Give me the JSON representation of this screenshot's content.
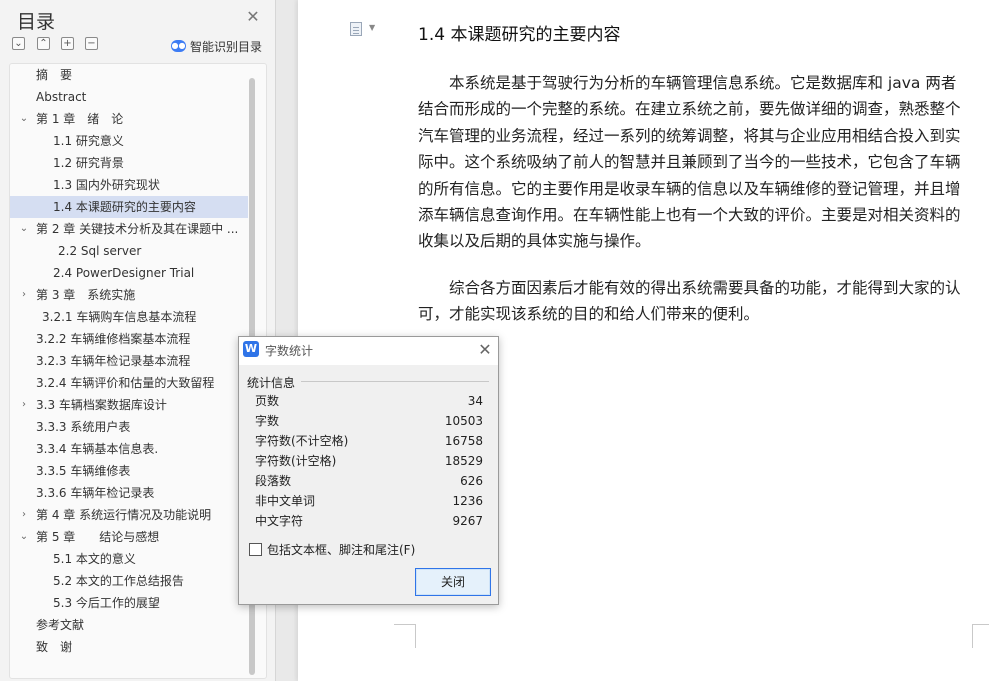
{
  "sidebar": {
    "title": "目录",
    "smart_toc_label": "智能识别目录",
    "tools": [
      "⌄",
      "⌃",
      "+",
      "−"
    ],
    "items": [
      {
        "label": "摘　要",
        "level": 0,
        "chevron": "",
        "selected": false
      },
      {
        "label": "Abstract",
        "level": 0,
        "chevron": "",
        "selected": false
      },
      {
        "label": "第 1 章　绪　论",
        "level": 0,
        "chevron": "expanded",
        "selected": false
      },
      {
        "label": "1.1 研究意义",
        "level": 1,
        "chevron": "",
        "selected": false
      },
      {
        "label": "1.2 研究背景",
        "level": 1,
        "chevron": "",
        "selected": false
      },
      {
        "label": "1.3 国内外研究现状",
        "level": 1,
        "chevron": "",
        "selected": false
      },
      {
        "label": "1.4 本课题研究的主要内容",
        "level": 1,
        "chevron": "",
        "selected": true
      },
      {
        "label": "第 2 章  关键技术分析及其在课题中 ...",
        "level": 0,
        "chevron": "expanded",
        "selected": false
      },
      {
        "label": "2.2 Sql server",
        "level": 2,
        "chevron": "",
        "selected": false
      },
      {
        "label": "2.4 PowerDesigner Trial",
        "level": 1,
        "chevron": "",
        "selected": false
      },
      {
        "label": "第 3 章　系统实施",
        "level": 0,
        "chevron": "collapsed",
        "selected": false
      },
      {
        "label": "3.2.1 车辆购车信息基本流程",
        "level": 3,
        "chevron": "",
        "selected": false
      },
      {
        "label": "3.2.2 车辆维修档案基本流程",
        "level": 0,
        "chevron": "",
        "selected": false
      },
      {
        "label": "3.2.3 车辆年检记录基本流程",
        "level": 0,
        "chevron": "",
        "selected": false
      },
      {
        "label": "3.2.4 车辆评价和估量的大致留程",
        "level": 0,
        "chevron": "",
        "selected": false
      },
      {
        "label": "3.3 车辆档案数据库设计",
        "level": 0,
        "chevron": "collapsed",
        "selected": false
      },
      {
        "label": "3.3.3 系统用户表",
        "level": 0,
        "chevron": "",
        "selected": false
      },
      {
        "label": "3.3.4 车辆基本信息表.",
        "level": 0,
        "chevron": "",
        "selected": false
      },
      {
        "label": "3.3.5 车辆维修表",
        "level": 0,
        "chevron": "",
        "selected": false
      },
      {
        "label": "3.3.6 车辆年检记录表",
        "level": 0,
        "chevron": "",
        "selected": false
      },
      {
        "label": "第 4 章  系统运行情况及功能说明",
        "level": 0,
        "chevron": "collapsed",
        "selected": false
      },
      {
        "label": "第 5 章　　结论与感想",
        "level": 0,
        "chevron": "expanded",
        "selected": false
      },
      {
        "label": "5.1 本文的意义",
        "level": 1,
        "chevron": "",
        "selected": false
      },
      {
        "label": "5.2 本文的工作总结报告",
        "level": 1,
        "chevron": "",
        "selected": false
      },
      {
        "label": "5.3 今后工作的展望",
        "level": 1,
        "chevron": "",
        "selected": false
      },
      {
        "label": "参考文献",
        "level": 0,
        "chevron": "",
        "selected": false
      },
      {
        "label": "致　谢",
        "level": 0,
        "chevron": "",
        "selected": false
      }
    ]
  },
  "document": {
    "heading": "1.4 本课题研究的主要内容",
    "paragraph1": [
      "　　本系统是基于驾驶行为分析的车辆管理信息系统。它是数据库和 java 两者",
      "结合而形成的一个完整的系统。在建立系统之前，要先做详细的调查，熟悉整个",
      "汽车管理的业务流程，经过一系列的统筹调整，将其与企业应用相结合投入到实",
      "际中。这个系统吸纳了前人的智慧并且兼顾到了当今的一些技术，它包含了车辆",
      "的所有信息。它的主要作用是收录车辆的信息以及车辆维修的登记管理，并且增",
      "添车辆信息查询作用。在车辆性能上也有一个大致的评价。主要是对相关资料的",
      "收集以及后期的具体实施与操作。"
    ],
    "paragraph2": [
      "　　综合各方面因素后才能有效的得出系统需要具备的功能，才能得到大家的认",
      "可，才能实现该系统的目的和给人们带来的便利。"
    ]
  },
  "dialog": {
    "title": "字数统计",
    "logo": "W",
    "section_label": "统计信息",
    "stats": [
      {
        "label": "页数",
        "value": "34"
      },
      {
        "label": "字数",
        "value": "10503"
      },
      {
        "label": "字符数(不计空格)",
        "value": "16758"
      },
      {
        "label": "字符数(计空格)",
        "value": "18529"
      },
      {
        "label": "段落数",
        "value": "626"
      },
      {
        "label": "非中文单词",
        "value": "1236"
      },
      {
        "label": "中文字符",
        "value": "9267"
      }
    ],
    "checkbox_label": "包括文本框、脚注和尾注(F)",
    "checkbox_checked": false,
    "close_button_label": "关闭"
  }
}
